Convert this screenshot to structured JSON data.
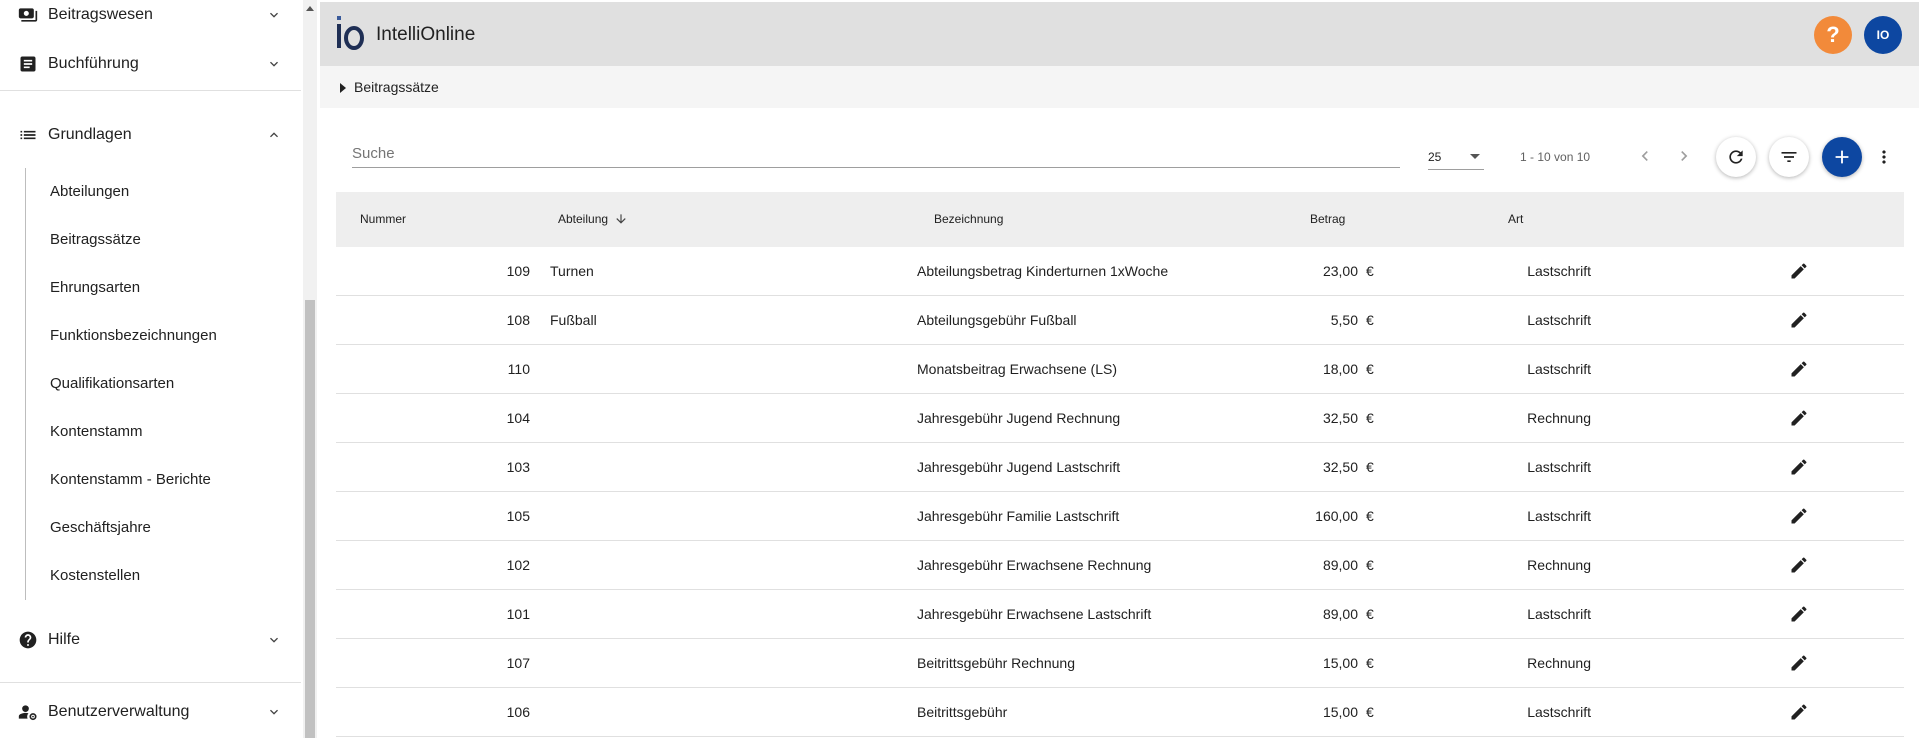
{
  "app": {
    "title": "IntelliOnline",
    "logo_text": "io"
  },
  "header": {
    "help_label": "?",
    "avatar_initials": "IO"
  },
  "breadcrumb": {
    "label": "Beitragssätze"
  },
  "sidebar": {
    "groups": [
      {
        "label": "Beitragswesen",
        "icon": "money-icon",
        "expanded": false
      },
      {
        "label": "Buchführung",
        "icon": "ledger-icon",
        "expanded": false
      },
      {
        "label": "Grundlagen",
        "icon": "list-icon",
        "expanded": true
      },
      {
        "label": "Hilfe",
        "icon": "help-circle-icon",
        "expanded": false
      },
      {
        "label": "Benutzerverwaltung",
        "icon": "user-settings-icon",
        "expanded": false
      }
    ],
    "sub_items": [
      "Abteilungen",
      "Beitragssätze",
      "Ehrungsarten",
      "Funktionsbezeichnungen",
      "Qualifikationsarten",
      "Kontenstamm",
      "Kontenstamm - Berichte",
      "Geschäftsjahre",
      "Kostenstellen"
    ]
  },
  "toolbar": {
    "search_placeholder": "Suche",
    "page_size": "25",
    "range": "1 - 10 von 10"
  },
  "table": {
    "columns": [
      "Nummer",
      "Abteilung",
      "Bezeichnung",
      "Betrag",
      "Art"
    ],
    "sort_column": "Abteilung",
    "rows": [
      {
        "nummer": "109",
        "abteilung": "Turnen",
        "bezeichnung": "Abteilungsbetrag Kinderturnen 1xWoche",
        "betrag": "23,00",
        "currency": "€",
        "art": "Lastschrift"
      },
      {
        "nummer": "108",
        "abteilung": "Fußball",
        "bezeichnung": "Abteilungsgebühr Fußball",
        "betrag": "5,50",
        "currency": "€",
        "art": "Lastschrift"
      },
      {
        "nummer": "110",
        "abteilung": "",
        "bezeichnung": "Monatsbeitrag Erwachsene (LS)",
        "betrag": "18,00",
        "currency": "€",
        "art": "Lastschrift"
      },
      {
        "nummer": "104",
        "abteilung": "",
        "bezeichnung": "Jahresgebühr Jugend Rechnung",
        "betrag": "32,50",
        "currency": "€",
        "art": "Rechnung"
      },
      {
        "nummer": "103",
        "abteilung": "",
        "bezeichnung": "Jahresgebühr Jugend Lastschrift",
        "betrag": "32,50",
        "currency": "€",
        "art": "Lastschrift"
      },
      {
        "nummer": "105",
        "abteilung": "",
        "bezeichnung": "Jahresgebühr Familie Lastschrift",
        "betrag": "160,00",
        "currency": "€",
        "art": "Lastschrift"
      },
      {
        "nummer": "102",
        "abteilung": "",
        "bezeichnung": "Jahresgebühr Erwachsene Rechnung",
        "betrag": "89,00",
        "currency": "€",
        "art": "Rechnung"
      },
      {
        "nummer": "101",
        "abteilung": "",
        "bezeichnung": "Jahresgebühr Erwachsene Lastschrift",
        "betrag": "89,00",
        "currency": "€",
        "art": "Lastschrift"
      },
      {
        "nummer": "107",
        "abteilung": "",
        "bezeichnung": "Beitrittsgebühr Rechnung",
        "betrag": "15,00",
        "currency": "€",
        "art": "Rechnung"
      },
      {
        "nummer": "106",
        "abteilung": "",
        "bezeichnung": "Beitrittsgebühr",
        "betrag": "15,00",
        "currency": "€",
        "art": "Lastschrift"
      }
    ]
  },
  "colors": {
    "accent": "#0d47a1",
    "help": "#f28a3a",
    "header_bg": "#e0e0e0"
  }
}
